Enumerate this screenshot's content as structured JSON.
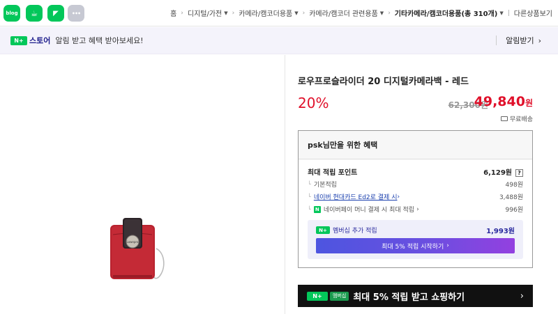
{
  "share": {
    "blog_label": "blog",
    "cafe_label": "☕",
    "talk_label": "◤",
    "more_label": "•••"
  },
  "breadcrumbs": [
    {
      "label": "홈"
    },
    {
      "label": "디지털/가전"
    },
    {
      "label": "카메라/캠코더용품"
    },
    {
      "label": "카메라/캠코더 관련용품"
    },
    {
      "label": "기타카메라/캠코더용품(총 310개)"
    },
    {
      "label": "다른상품보기"
    }
  ],
  "store_notice": {
    "badge": "N+",
    "store": "스토어",
    "text": "알림 받고 혜택 받아보세요!",
    "alarm_button": "알림받기"
  },
  "product": {
    "title": "로우프로슬라이더 20 디지털카메라백 - 레드",
    "discount": "20%",
    "original_price": "62,300원",
    "sale_price": "49,840",
    "sale_unit": "원",
    "shipping": "무료배송",
    "image_label": "Lowepro"
  },
  "benefits": {
    "user": "psk",
    "header_suffix": "님만을 위한 혜택",
    "max_points_label": "최대 적립 포인트",
    "max_points_value": "6,129원",
    "help_mark": "?",
    "rows": [
      {
        "label": "기본적립",
        "value": "498원"
      },
      {
        "label": "네이버 현대카드 Ed2로 결제 시",
        "value": "3,488원"
      },
      {
        "label": "네이버페이 머니 결제 시 최대 적립",
        "value": "996원"
      }
    ],
    "pay_badge": "N",
    "membership_label": "멤버십 추가 적립",
    "membership_badge": "N+",
    "membership_value": "1,993원",
    "membership_button": "최대 5% 적립 시작하기"
  },
  "promo": {
    "badge": "N+",
    "member_badge": "멤버십",
    "text": "최대 5% 적립 받고 쇼핑하기"
  },
  "colors": {
    "naver_green": "#03c75a",
    "price_red": "#e0102a",
    "member_purple": "#6a4fe0"
  }
}
